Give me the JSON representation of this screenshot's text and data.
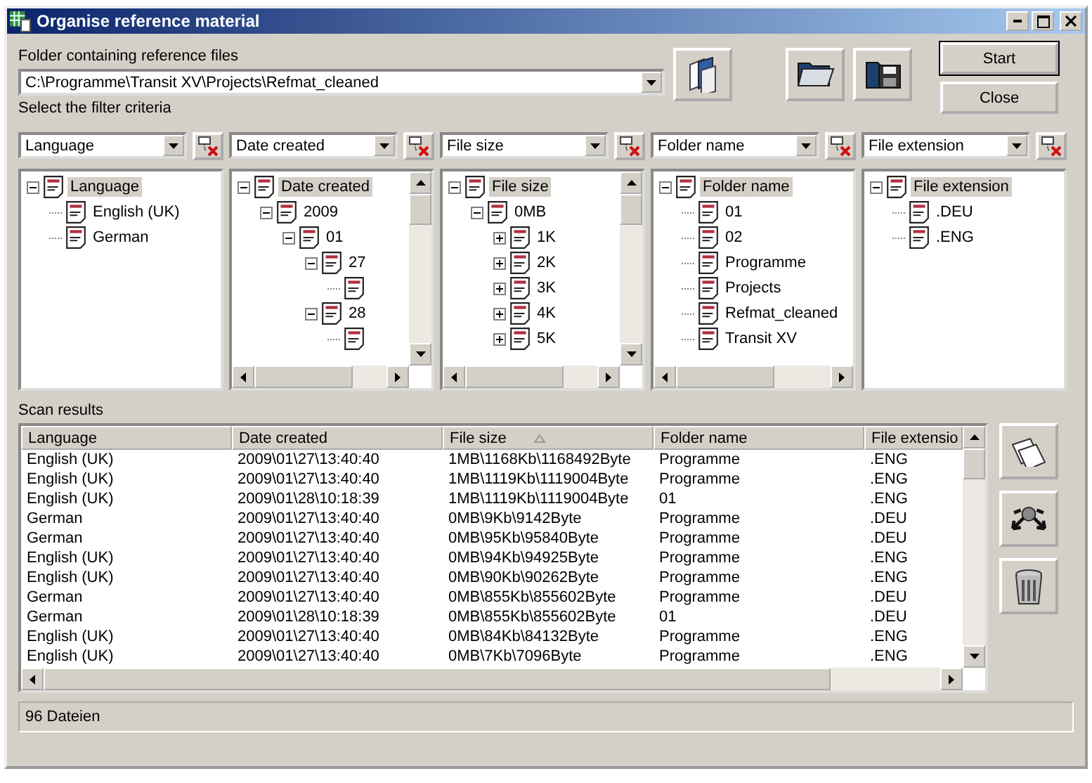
{
  "window": {
    "title": "Organise reference material"
  },
  "folder": {
    "label": "Folder containing reference files",
    "value": "C:\\Programme\\Transit XV\\Projects\\Refmat_cleaned"
  },
  "buttons": [
    {
      "label": "Start"
    },
    {
      "label": "Close"
    }
  ],
  "filter_label": "Select the filter criteria",
  "filters": [
    {
      "value": "Language",
      "tree": [
        {
          "kind": "document",
          "label": "Language",
          "selected": true,
          "expanded": true,
          "children": [
            {
              "kind": "document",
              "label": "English (UK)"
            },
            {
              "kind": "document",
              "label": "German"
            }
          ]
        }
      ]
    },
    {
      "value": "Date created",
      "tree": [
        {
          "kind": "document",
          "label": "Date created",
          "selected": true,
          "expanded": true,
          "children": [
            {
              "kind": "document",
              "label": "2009",
              "expanded": true,
              "children": [
                {
                  "kind": "document",
                  "label": "01",
                  "expanded": true,
                  "children": [
                    {
                      "kind": "document",
                      "label": "27",
                      "expanded": true,
                      "children": [
                        {
                          "kind": "document"
                        }
                      ]
                    },
                    {
                      "kind": "document",
                      "label": "28",
                      "expanded": true,
                      "children": [
                        {
                          "kind": "document"
                        }
                      ]
                    }
                  ]
                }
              ]
            }
          ]
        }
      ]
    },
    {
      "value": "File size",
      "tree": [
        {
          "kind": "document",
          "label": "File size",
          "selected": true,
          "expanded": true,
          "children": [
            {
              "kind": "document",
              "label": "0MB",
              "expanded": true,
              "children": [
                {
                  "kind": "document",
                  "label": "1K",
                  "expanded": false
                },
                {
                  "kind": "document",
                  "label": "2K",
                  "expanded": false
                },
                {
                  "kind": "document",
                  "label": "3K",
                  "expanded": false
                },
                {
                  "kind": "document",
                  "label": "4K",
                  "expanded": false
                },
                {
                  "kind": "document",
                  "label": "5K",
                  "expanded": false
                }
              ]
            }
          ]
        }
      ]
    },
    {
      "value": "Folder name",
      "tree": [
        {
          "kind": "document",
          "label": "Folder name",
          "selected": true,
          "expanded": true,
          "children": [
            {
              "kind": "document",
              "label": "01"
            },
            {
              "kind": "document",
              "label": "02"
            },
            {
              "kind": "document",
              "label": "Programme"
            },
            {
              "kind": "document",
              "label": "Projects"
            },
            {
              "kind": "document",
              "label": "Refmat_cleaned"
            },
            {
              "kind": "document",
              "label": "Transit XV"
            }
          ]
        }
      ]
    },
    {
      "value": "File extension",
      "tree": [
        {
          "kind": "document",
          "label": "File extension",
          "selected": true,
          "expanded": true,
          "children": [
            {
              "kind": "document",
              "label": ".DEU"
            },
            {
              "kind": "document",
              "label": ".ENG"
            }
          ]
        }
      ]
    }
  ],
  "scan_results": {
    "label": "Scan results",
    "columns": [
      {
        "label": "Language",
        "sorted": false
      },
      {
        "label": "Date created",
        "sorted": false
      },
      {
        "label": "File size",
        "sorted": true
      },
      {
        "label": "Folder name",
        "sorted": false
      },
      {
        "label": "File extensio",
        "sorted": false
      }
    ],
    "rows": [
      [
        "English (UK)",
        "2009\\01\\27\\13:40:40",
        "1MB\\1168Kb\\1168492Byte",
        "Programme",
        ".ENG"
      ],
      [
        "English (UK)",
        "2009\\01\\27\\13:40:40",
        "1MB\\1119Kb\\1119004Byte",
        "Programme",
        ".ENG"
      ],
      [
        "English (UK)",
        "2009\\01\\28\\10:18:39",
        "1MB\\1119Kb\\1119004Byte",
        "01",
        ".ENG"
      ],
      [
        "German",
        "2009\\01\\27\\13:40:40",
        "0MB\\9Kb\\9142Byte",
        "Programme",
        ".DEU"
      ],
      [
        "German",
        "2009\\01\\27\\13:40:40",
        "0MB\\95Kb\\95840Byte",
        "Programme",
        ".DEU"
      ],
      [
        "English (UK)",
        "2009\\01\\27\\13:40:40",
        "0MB\\94Kb\\94925Byte",
        "Programme",
        ".ENG"
      ],
      [
        "English (UK)",
        "2009\\01\\27\\13:40:40",
        "0MB\\90Kb\\90262Byte",
        "Programme",
        ".ENG"
      ],
      [
        "German",
        "2009\\01\\27\\13:40:40",
        "0MB\\855Kb\\855602Byte",
        "Programme",
        ".DEU"
      ],
      [
        "German",
        "2009\\01\\28\\10:18:39",
        "0MB\\855Kb\\855602Byte",
        "01",
        ".DEU"
      ],
      [
        "English (UK)",
        "2009\\01\\27\\13:40:40",
        "0MB\\84Kb\\84132Byte",
        "Programme",
        ".ENG"
      ],
      [
        "English (UK)",
        "2009\\01\\27\\13:40:40",
        "0MB\\7Kb\\7096Byte",
        "Programme",
        ".ENG"
      ]
    ]
  },
  "status_bar": "96 Dateien"
}
